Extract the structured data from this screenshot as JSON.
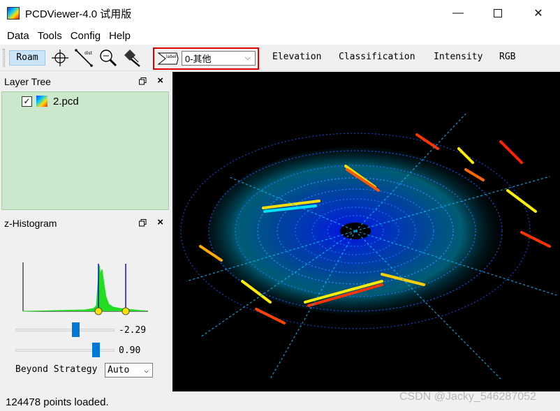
{
  "window": {
    "title": "PCDViewer-4.0 试用版",
    "min_glyph": "—",
    "close_glyph": "✕"
  },
  "menu": [
    "Data",
    "Tools",
    "Config",
    "Help"
  ],
  "toolbar": {
    "roam_label": "Roam",
    "icons": [
      "crosshair-icon",
      "distance-icon",
      "zoom-icon",
      "eraser-icon"
    ],
    "label_select_value": "0-其他",
    "label_icon_text": "label",
    "modes": [
      "Elevation",
      "Classification",
      "Intensity",
      "RGB"
    ]
  },
  "layer_tree": {
    "title": "Layer Tree",
    "layers": [
      {
        "name": "2.pcd",
        "checked": true
      }
    ]
  },
  "histogram": {
    "title": "z-Histogram",
    "low_value_label": "-2.29",
    "high_value_label": "0.90",
    "low_slider_fraction": 0.62,
    "high_slider_fraction": 0.82,
    "beyond_strategy_label": "Beyond Strategy",
    "beyond_strategy_value": "Auto",
    "line_color": "#22dd22",
    "marker_color": "#0000cc"
  },
  "status": {
    "text": "124478 points loaded."
  },
  "watermark": "CSDN @Jacky_546287052"
}
